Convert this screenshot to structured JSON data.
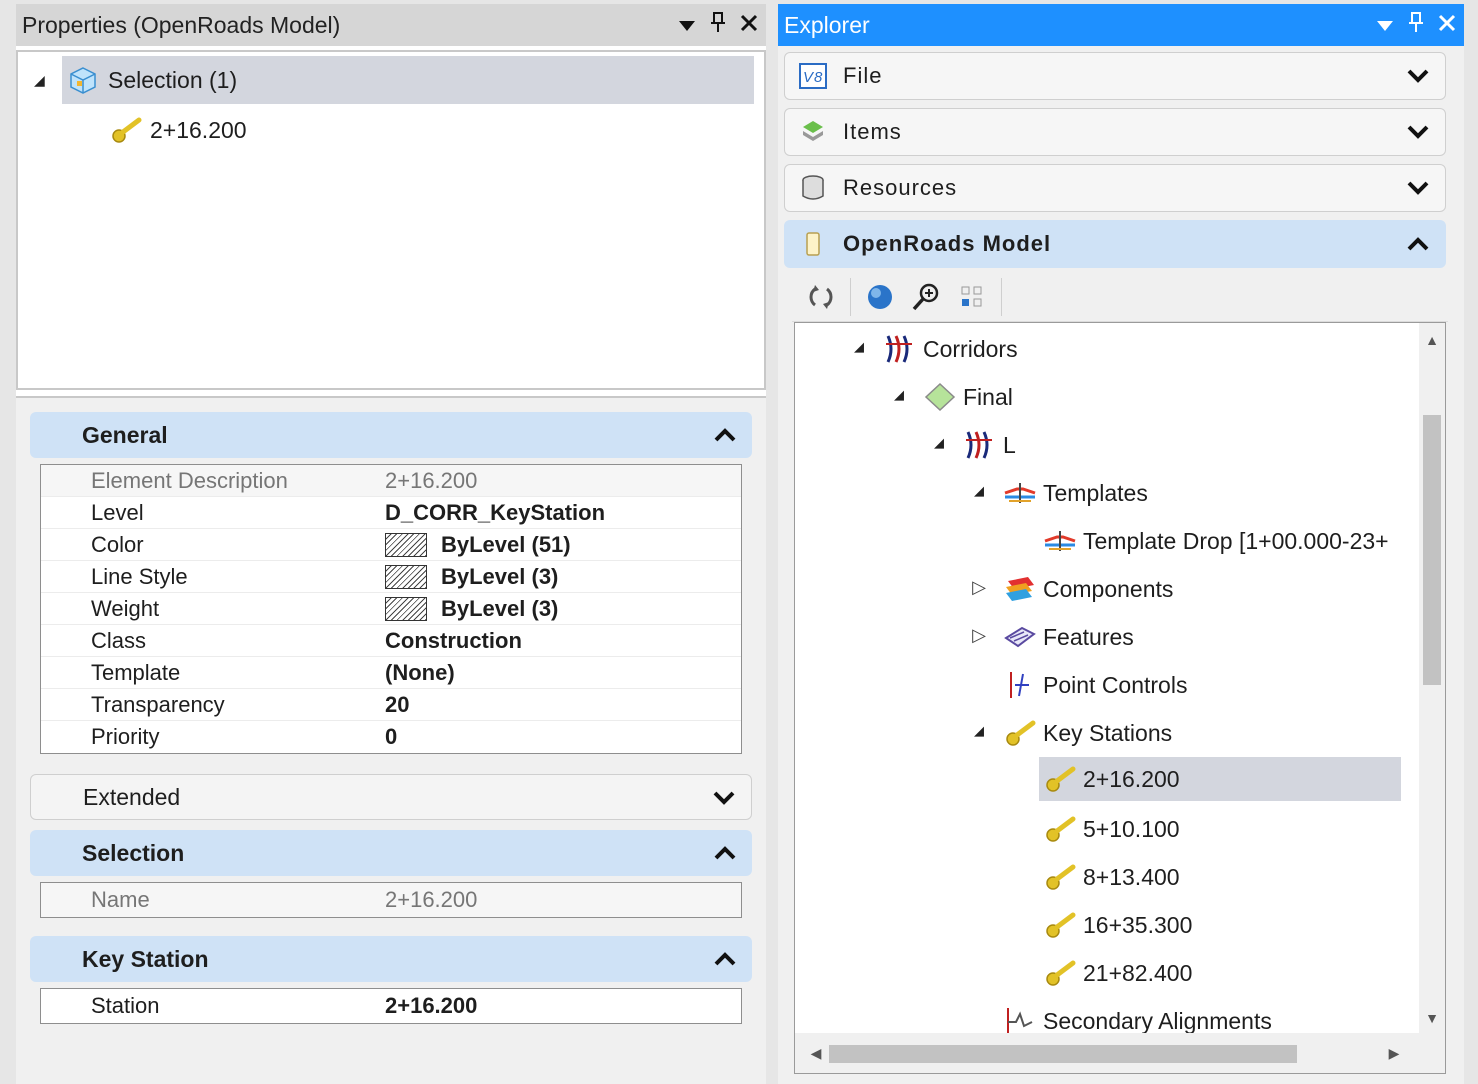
{
  "properties_panel": {
    "title": "Properties (OpenRoads Model)",
    "title_buttons": {
      "dropdown": "▼",
      "pin": "⊥",
      "close": "✕"
    },
    "selection_node": {
      "label": "Selection (1)",
      "child": "2+16.200"
    },
    "sections": {
      "general": {
        "header": "General",
        "rows": [
          {
            "name": "Element Description",
            "value": "2+16.200",
            "readonly": true
          },
          {
            "name": "Level",
            "value": "D_CORR_KeyStation"
          },
          {
            "name": "Color",
            "value": "ByLevel (51)",
            "swatch": true
          },
          {
            "name": "Line Style",
            "value": "ByLevel (3)",
            "swatch": true
          },
          {
            "name": "Weight",
            "value": "ByLevel (3)",
            "swatch": true
          },
          {
            "name": "Class",
            "value": "Construction"
          },
          {
            "name": "Template",
            "value": "(None)"
          },
          {
            "name": "Transparency",
            "value": "20"
          },
          {
            "name": "Priority",
            "value": "0"
          }
        ]
      },
      "extended": {
        "header": "Extended"
      },
      "selection": {
        "header": "Selection",
        "rows": [
          {
            "name": "Name",
            "value": "2+16.200",
            "readonly": true
          }
        ]
      },
      "key_station": {
        "header": "Key Station",
        "rows": [
          {
            "name": "Station",
            "value": "2+16.200"
          }
        ]
      }
    }
  },
  "explorer_panel": {
    "title": "Explorer",
    "accordion": {
      "file": "File",
      "items": "Items",
      "resources": "Resources",
      "openroads_model": "OpenRoads Model"
    },
    "tree": {
      "corridors": "Corridors",
      "final": "Final",
      "l": "L",
      "templates": "Templates",
      "template_drop": "Template Drop [1+00.000-23+",
      "components": "Components",
      "features": "Features",
      "point_controls": "Point Controls",
      "key_stations": "Key Stations",
      "ks": [
        "2+16.200",
        "5+10.100",
        "8+13.400",
        "16+35.300",
        "21+82.400"
      ],
      "secondary_alignments": "Secondary Alignments"
    },
    "colors": {
      "title_bar": "#1e90ff",
      "selected_row": "#d3d6de",
      "section_active": "#cfe2f6"
    }
  }
}
